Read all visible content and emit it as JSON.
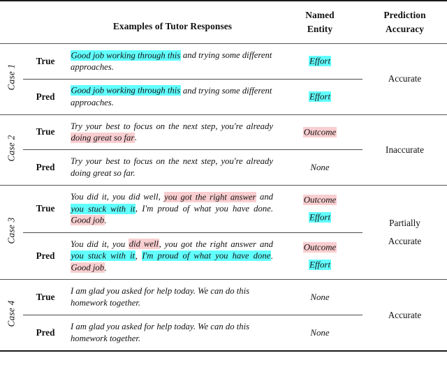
{
  "header": {
    "col_examples": "Examples of Tutor Responses",
    "col_entity_line1": "Named",
    "col_entity_line2": "Entity",
    "col_accuracy_line1": "Prediction",
    "col_accuracy_line2": "Accuracy"
  },
  "colors": {
    "highlight_cyan": "#62ffff",
    "highlight_pink": "#f9ced0",
    "rule_dark": "#1a1a1a",
    "rule_gray": "#555555",
    "text": "#111111"
  },
  "labels": {
    "true": "True",
    "pred": "Pred"
  },
  "cases": [
    {
      "case_label": "Case 1",
      "accuracy": "Accurate",
      "accuracy_line1": "Accurate",
      "accuracy_line2": "",
      "true": {
        "label": "True",
        "text": "Good job working through this and trying some different approaches.",
        "segments": [
          {
            "t": "Good job working through this",
            "h": "cyan"
          },
          {
            "t": " and trying some different approaches.",
            "h": "none"
          }
        ],
        "entities": [
          {
            "t": "Effort",
            "h": "cyan"
          }
        ]
      },
      "pred": {
        "label": "Pred",
        "text": "Good job working through this and trying some different approaches.",
        "segments": [
          {
            "t": "Good job working through this",
            "h": "cyan"
          },
          {
            "t": " and trying some different approaches.",
            "h": "none"
          }
        ],
        "entities": [
          {
            "t": "Effort",
            "h": "cyan"
          }
        ]
      }
    },
    {
      "case_label": "Case 2",
      "accuracy": "Inaccurate",
      "accuracy_line1": "Inaccurate",
      "accuracy_line2": "",
      "true": {
        "label": "True",
        "text": "Try your best to focus on the next step, you're already doing great so far.",
        "segments": [
          {
            "t": "Try your best to focus on the next step, you're already ",
            "h": "none"
          },
          {
            "t": "doing great so far",
            "h": "pink"
          },
          {
            "t": ".",
            "h": "none"
          }
        ],
        "entities": [
          {
            "t": "Outcome",
            "h": "pink"
          }
        ]
      },
      "pred": {
        "label": "Pred",
        "text": "Try your best to focus on the next step, you're already doing great so far.",
        "segments": [
          {
            "t": "Try your best to focus on the next step, you're already doing great so far.",
            "h": "none"
          }
        ],
        "entities": [
          {
            "t": "None",
            "h": "none"
          }
        ]
      }
    },
    {
      "case_label": "Case 3",
      "accuracy": "Partially Accurate",
      "accuracy_line1": "Partially",
      "accuracy_line2": "Accurate",
      "true": {
        "label": "True",
        "text": "You did it, you did well, you got the right answer and you stuck with it, I'm proud of what you have done. Good job.",
        "segments": [
          {
            "t": "You did it, you did well, ",
            "h": "none"
          },
          {
            "t": "you got the right answer",
            "h": "pink"
          },
          {
            "t": " and ",
            "h": "none"
          },
          {
            "t": "you stuck with it",
            "h": "cyan"
          },
          {
            "t": ", I'm proud of what you have done. ",
            "h": "none"
          },
          {
            "t": "Good job",
            "h": "pink"
          },
          {
            "t": ".",
            "h": "none"
          }
        ],
        "entities": [
          {
            "t": "Outcome",
            "h": "pink"
          },
          {
            "t": "Effort",
            "h": "cyan"
          }
        ]
      },
      "pred": {
        "label": "Pred",
        "text": "You did it, you did well, you got the right answer and you stuck with it, I'm proud of what you have done. Good job.",
        "segments": [
          {
            "t": "You did it, you ",
            "h": "none"
          },
          {
            "t": "did well",
            "h": "pink"
          },
          {
            "t": ", you got the right answer and ",
            "h": "none"
          },
          {
            "t": "you stuck with it",
            "h": "cyan"
          },
          {
            "t": ", ",
            "h": "none"
          },
          {
            "t": "I'm proud of what you have done",
            "h": "cyan"
          },
          {
            "t": ". ",
            "h": "none"
          },
          {
            "t": "Good job",
            "h": "pink"
          },
          {
            "t": ".",
            "h": "none"
          }
        ],
        "entities": [
          {
            "t": "Outcome",
            "h": "pink"
          },
          {
            "t": "Effort",
            "h": "cyan"
          }
        ]
      }
    },
    {
      "case_label": "Case 4",
      "accuracy": "Accurate",
      "accuracy_line1": "Accurate",
      "accuracy_line2": "",
      "true": {
        "label": "True",
        "text": "I am glad you asked for help today. We can do this homework together.",
        "segments": [
          {
            "t": "I am glad you asked for help today. We can do this homework together.",
            "h": "none"
          }
        ],
        "entities": [
          {
            "t": "None",
            "h": "none"
          }
        ]
      },
      "pred": {
        "label": "Pred",
        "text": "I am glad you asked for help today. We can do this homework together.",
        "segments": [
          {
            "t": "I am glad you asked for help today. We can do this homework together.",
            "h": "none"
          }
        ],
        "entities": [
          {
            "t": "None",
            "h": "none"
          }
        ]
      }
    }
  ]
}
